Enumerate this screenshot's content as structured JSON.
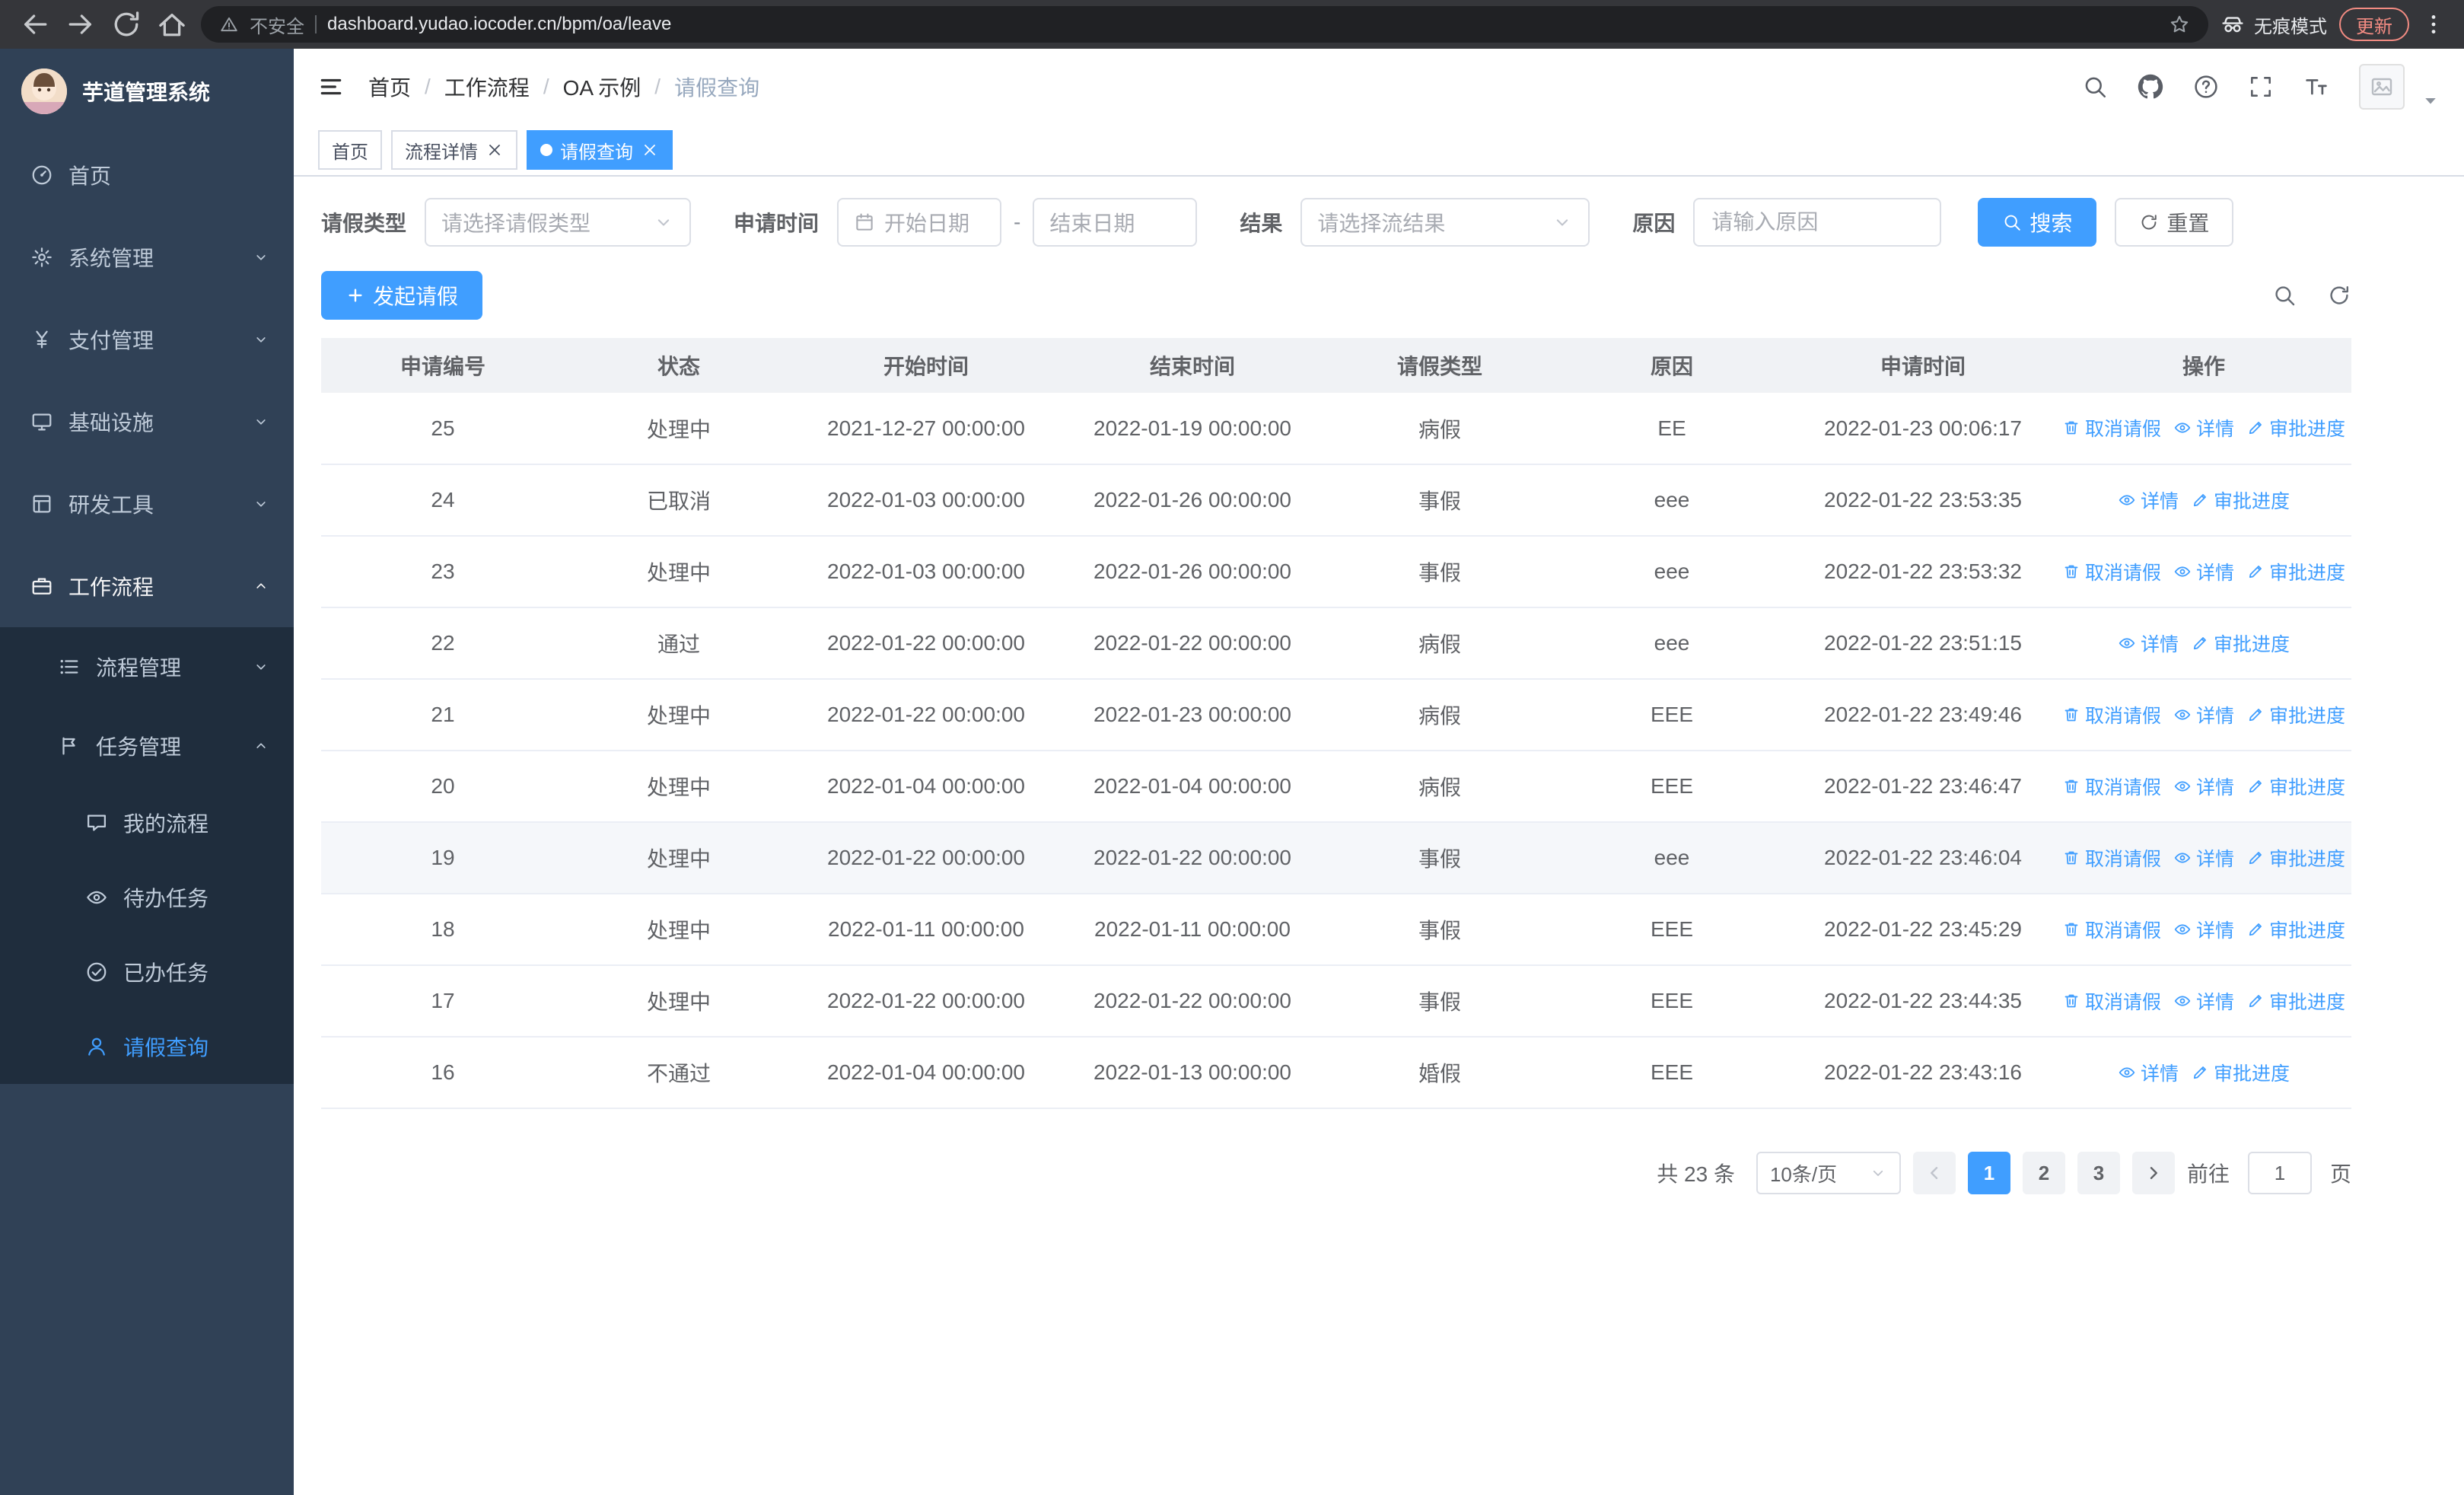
{
  "browser": {
    "security_label": "不安全",
    "url": "dashboard.yudao.iocoder.cn/bpm/oa/leave",
    "incognito_label": "无痕模式",
    "update_label": "更新"
  },
  "sidebar": {
    "logo_title": "芋道管理系统",
    "menu": [
      {
        "label": "首页",
        "icon": "dashboard-icon",
        "level": 0
      },
      {
        "label": "系统管理",
        "icon": "gear-icon",
        "level": 0,
        "chevron": "down"
      },
      {
        "label": "支付管理",
        "icon": "yen-icon",
        "level": 0,
        "chevron": "down"
      },
      {
        "label": "基础设施",
        "icon": "infra-icon",
        "level": 0,
        "chevron": "down"
      },
      {
        "label": "研发工具",
        "icon": "tools-icon",
        "level": 0,
        "chevron": "down"
      },
      {
        "label": "工作流程",
        "icon": "workflow-icon",
        "level": 0,
        "chevron": "up",
        "parent_active": true
      },
      {
        "label": "流程管理",
        "icon": "process-icon",
        "level": 1,
        "chevron": "down"
      },
      {
        "label": "任务管理",
        "icon": "task-icon",
        "level": 1,
        "chevron": "up"
      },
      {
        "label": "我的流程",
        "icon": "chat-icon",
        "level": 2
      },
      {
        "label": "待办任务",
        "icon": "eye-icon",
        "level": 2
      },
      {
        "label": "已办任务",
        "icon": "done-icon",
        "level": 2
      },
      {
        "label": "请假查询",
        "icon": "user-icon",
        "level": 2,
        "active": true
      }
    ]
  },
  "header": {
    "breadcrumb": [
      "首页",
      "工作流程",
      "OA 示例",
      "请假查询"
    ],
    "breadcrumb_sep": "/"
  },
  "tabs": [
    {
      "label": "首页"
    },
    {
      "label": "流程详情",
      "closable": true
    },
    {
      "label": "请假查询",
      "closable": true,
      "active": true
    }
  ],
  "filters": {
    "leave_type_label": "请假类型",
    "leave_type_placeholder": "请选择请假类型",
    "apply_time_label": "申请时间",
    "start_date_placeholder": "开始日期",
    "date_separator": "-",
    "end_date_placeholder": "结束日期",
    "result_label": "结果",
    "result_placeholder": "请选择流结果",
    "reason_label": "原因",
    "reason_placeholder": "请输入原因",
    "search_label": "搜索",
    "reset_label": "重置"
  },
  "toolbar": {
    "create_label": "发起请假"
  },
  "table": {
    "columns": [
      "申请编号",
      "状态",
      "开始时间",
      "结束时间",
      "请假类型",
      "原因",
      "申请时间",
      "操作"
    ],
    "op_labels": {
      "cancel": "取消请假",
      "detail": "详情",
      "progress": "审批进度"
    },
    "rows": [
      {
        "id": "25",
        "status": "处理中",
        "start": "2021-12-27 00:00:00",
        "end": "2022-01-19 00:00:00",
        "type": "病假",
        "reason": "EE",
        "applied": "2022-01-23 00:06:17",
        "ops": [
          "cancel",
          "detail",
          "progress"
        ]
      },
      {
        "id": "24",
        "status": "已取消",
        "start": "2022-01-03 00:00:00",
        "end": "2022-01-26 00:00:00",
        "type": "事假",
        "reason": "eee",
        "applied": "2022-01-22 23:53:35",
        "ops": [
          "detail",
          "progress"
        ]
      },
      {
        "id": "23",
        "status": "处理中",
        "start": "2022-01-03 00:00:00",
        "end": "2022-01-26 00:00:00",
        "type": "事假",
        "reason": "eee",
        "applied": "2022-01-22 23:53:32",
        "ops": [
          "cancel",
          "detail",
          "progress"
        ]
      },
      {
        "id": "22",
        "status": "通过",
        "start": "2022-01-22 00:00:00",
        "end": "2022-01-22 00:00:00",
        "type": "病假",
        "reason": "eee",
        "applied": "2022-01-22 23:51:15",
        "ops": [
          "detail",
          "progress"
        ]
      },
      {
        "id": "21",
        "status": "处理中",
        "start": "2022-01-22 00:00:00",
        "end": "2022-01-23 00:00:00",
        "type": "病假",
        "reason": "EEE",
        "applied": "2022-01-22 23:49:46",
        "ops": [
          "cancel",
          "detail",
          "progress"
        ]
      },
      {
        "id": "20",
        "status": "处理中",
        "start": "2022-01-04 00:00:00",
        "end": "2022-01-04 00:00:00",
        "type": "病假",
        "reason": "EEE",
        "applied": "2022-01-22 23:46:47",
        "ops": [
          "cancel",
          "detail",
          "progress"
        ]
      },
      {
        "id": "19",
        "status": "处理中",
        "start": "2022-01-22 00:00:00",
        "end": "2022-01-22 00:00:00",
        "type": "事假",
        "reason": "eee",
        "applied": "2022-01-22 23:46:04",
        "ops": [
          "cancel",
          "detail",
          "progress"
        ],
        "highlighted": true
      },
      {
        "id": "18",
        "status": "处理中",
        "start": "2022-01-11 00:00:00",
        "end": "2022-01-11 00:00:00",
        "type": "事假",
        "reason": "EEE",
        "applied": "2022-01-22 23:45:29",
        "ops": [
          "cancel",
          "detail",
          "progress"
        ]
      },
      {
        "id": "17",
        "status": "处理中",
        "start": "2022-01-22 00:00:00",
        "end": "2022-01-22 00:00:00",
        "type": "事假",
        "reason": "EEE",
        "applied": "2022-01-22 23:44:35",
        "ops": [
          "cancel",
          "detail",
          "progress"
        ]
      },
      {
        "id": "16",
        "status": "不通过",
        "start": "2022-01-04 00:00:00",
        "end": "2022-01-13 00:00:00",
        "type": "婚假",
        "reason": "EEE",
        "applied": "2022-01-22 23:43:16",
        "ops": [
          "detail",
          "progress"
        ]
      }
    ]
  },
  "pagination": {
    "total_text": "共 23 条",
    "page_size": "10条/页",
    "pages": [
      "1",
      "2",
      "3"
    ],
    "active_page": "1",
    "jump_prefix": "前往",
    "jump_value": "1",
    "jump_suffix": "页"
  },
  "colors": {
    "primary": "#409eff",
    "sidebar_bg": "#304156",
    "submenu_bg": "#1f2d3d",
    "table_header_bg": "#f0f2f5"
  }
}
